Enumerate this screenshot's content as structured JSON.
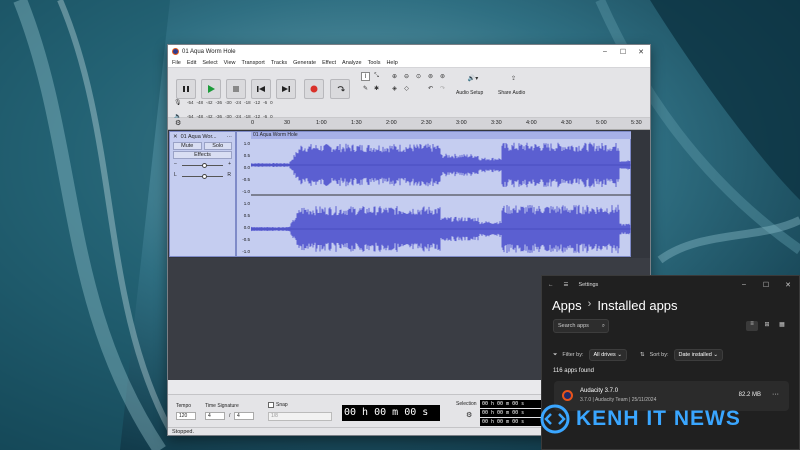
{
  "colors": {
    "accent": "#5b5fd1",
    "track_bg": "#c5cdf0",
    "settings_bg": "#202020",
    "watermark": "#3aa6ff"
  },
  "audacity": {
    "title": "01 Aqua Worm Hole",
    "window_controls": [
      "–",
      "☐",
      "✕"
    ],
    "menu": [
      "File",
      "Edit",
      "Select",
      "View",
      "Transport",
      "Tracks",
      "Generate",
      "Effect",
      "Analyze",
      "Tools",
      "Help"
    ],
    "toolbar": {
      "pause_icon": "pause-icon",
      "play_icon": "play-icon",
      "stop_icon": "stop-icon",
      "skip_start_icon": "skip-start-icon",
      "skip_end_icon": "skip-end-icon",
      "record_icon": "record-icon",
      "loop_icon": "loop-icon",
      "audio_setup_label": "Audio Setup",
      "share_audio_label": "Share Audio"
    },
    "meter_scale": [
      "-54",
      "-48",
      "-42",
      "-36",
      "-30",
      "-24",
      "-18",
      "-12",
      "-6",
      "0"
    ],
    "ruler_ticks": [
      "0",
      "30",
      "1:00",
      "1:30",
      "2:00",
      "2:30",
      "3:00",
      "3:30",
      "4:00",
      "4:30",
      "5:00",
      "5:30"
    ],
    "track": {
      "name": "01 Aqua Wor...",
      "mute": "Mute",
      "solo": "Solo",
      "effects": "Effects",
      "gain_min": "–",
      "gain_max": "+",
      "pan_left": "L",
      "pan_right": "R",
      "clip_name": "01 Aqua Worm Hole",
      "scale": [
        "1.0",
        "0.5",
        "0.0",
        "-0.5",
        "-1.0"
      ]
    },
    "bottom": {
      "tempo_label": "Tempo",
      "tempo_value": "120",
      "time_sig_label": "Time Signature",
      "time_sig_num": "4",
      "time_sig_sep": "/",
      "time_sig_den": "4",
      "snap_label": "Snap",
      "snap_value": "1/8",
      "time_display": "00 h 00 m 00 s",
      "selection_label": "Selection",
      "sel_start": "00 h 00 m 00 s",
      "sel_end": "00 h 00 m 00 s",
      "sel_third": "00 h 00 m 00 s"
    },
    "status": "Stopped."
  },
  "settings": {
    "title": "Settings",
    "back_icon": "back-arrow-icon",
    "window_controls": [
      "–",
      "☐",
      "✕"
    ],
    "crumb_parent": "Apps",
    "crumb_sep": "›",
    "crumb_current": "Installed apps",
    "search_placeholder": "Search apps",
    "filter_label": "Filter by:",
    "filter_value": "All drives",
    "sort_label": "Sort by:",
    "sort_value": "Date installed",
    "apps_found": "116 apps found",
    "app": {
      "name": "Audacity 3.7.0",
      "version": "3.7.0",
      "publisher": "Audacity Team",
      "date": "25/11/2024",
      "size": "82.2 MB",
      "more": "···"
    }
  },
  "watermark": {
    "text": "KENH IT NEWS"
  }
}
